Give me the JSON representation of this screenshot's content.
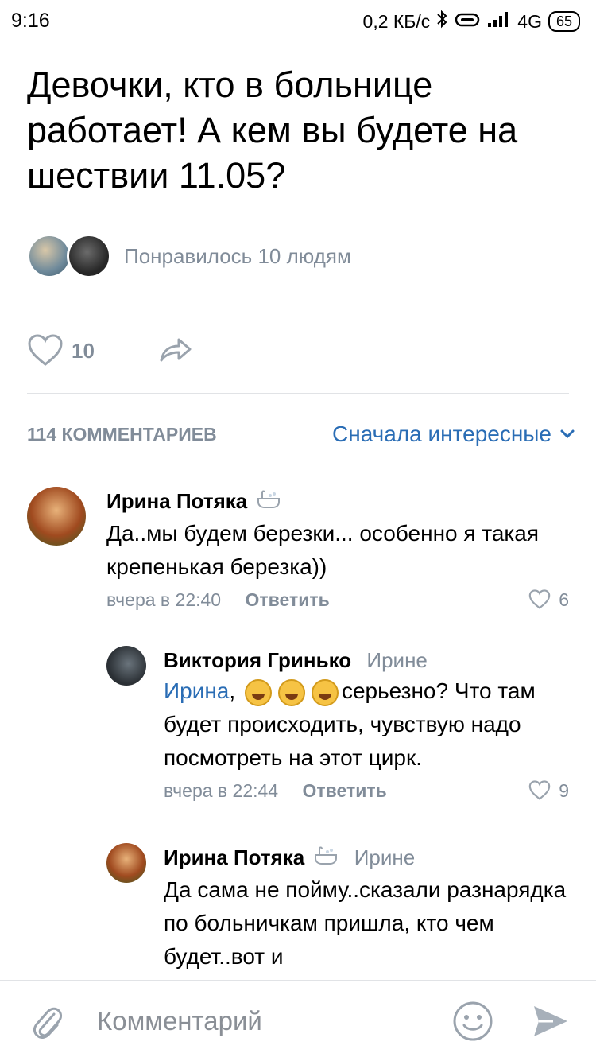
{
  "status_bar": {
    "time": "9:16",
    "net_speed": "0,2 КБ/с",
    "network": "4G",
    "battery": "65"
  },
  "post": {
    "text": "Девочки, кто в больнице работает! А кем вы будете на шествии 11.05?",
    "likes_text": "Понравилось 10 людям",
    "like_count": "10"
  },
  "comments_header": {
    "count_label": "114 КОММЕНТАРИЕВ",
    "sort_label": "Сначала интересные"
  },
  "comments": [
    {
      "author": "Ирина Потяка",
      "text": "Да..мы будем березки... особенно я такая крепенькая березка))",
      "time": "вчера в 22:40",
      "reply_label": "Ответить",
      "likes": "6"
    },
    {
      "author": "Виктория Гринько",
      "reply_to": "Ирине",
      "mention": "Ирина",
      "text": "серьезно?  Что там будет происходить,  чувствую надо посмотреть на этот цирк.",
      "time": "вчера в 22:44",
      "reply_label": "Ответить",
      "likes": "9"
    },
    {
      "author": "Ирина Потяка",
      "reply_to": "Ирине",
      "text": "Да сама не пойму..сказали разнарядка по больничкам пришла, кто чем будет..вот и"
    }
  ],
  "composer": {
    "placeholder": "Комментарий"
  },
  "colors": {
    "accent": "#2a6db5",
    "secondary_text": "#818c99",
    "divider": "#e1e3e6"
  },
  "icons": [
    "bluetooth-icon",
    "vibrate-icon",
    "signal-icon",
    "heart-icon",
    "share-icon",
    "chevron-down-icon",
    "bathtub-icon",
    "laughing-emoji-icon",
    "paperclip-icon",
    "smile-icon",
    "send-icon"
  ]
}
